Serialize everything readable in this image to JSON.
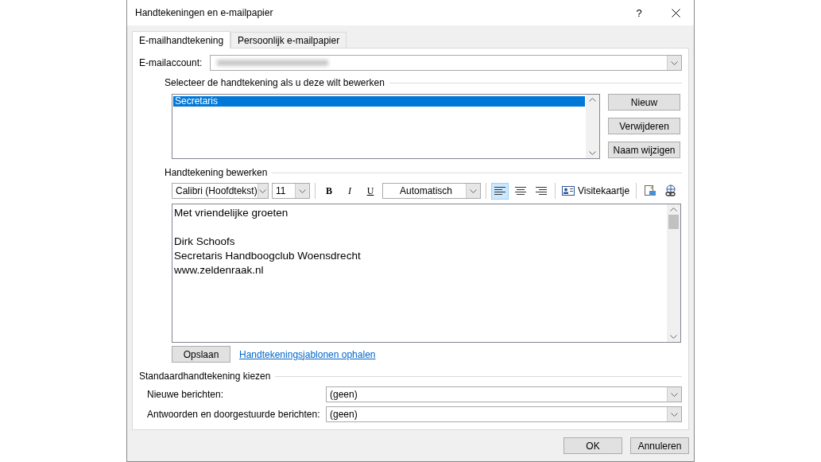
{
  "window": {
    "title": "Handtekeningen en e-mailpapier",
    "help": "?"
  },
  "tabs": [
    {
      "label": "E-mailhandtekening",
      "selected": true
    },
    {
      "label": "Persoonlijk e-mailpapier",
      "selected": false
    }
  ],
  "account": {
    "label": "E-mailaccount:"
  },
  "signatures": {
    "heading": "Selecteer de handtekening als u deze wilt bewerken",
    "items": [
      {
        "label": "Secretaris",
        "selected": true
      }
    ],
    "buttons": [
      "Nieuw",
      "Verwijderen",
      "Naam wijzigen"
    ]
  },
  "editor": {
    "heading": "Handtekening bewerken",
    "font": "Calibri (Hoofdtekst)",
    "size": "11",
    "text_color_choice": "Automatisch",
    "format": [
      {
        "label": "B",
        "kind": "bold"
      },
      {
        "label": "I",
        "kind": "italic"
      },
      {
        "label": "U",
        "kind": "underline"
      }
    ],
    "align": [
      {
        "kind": "left",
        "selected": true
      },
      {
        "kind": "center",
        "selected": false
      },
      {
        "kind": "right",
        "selected": false
      }
    ],
    "business_card": "Visitekaartje",
    "paragraphs": [
      [
        "Met vriendelijke groeten"
      ],
      [
        "Dirk Schoofs",
        "Secretaris Handboogclub Woensdrecht",
        "www.zeldenraak.nl"
      ]
    ]
  },
  "save": "Opslaan",
  "templates_link": "Handtekeningsjablonen ophalen",
  "defaults": {
    "heading": "Standaardhandtekening kiezen",
    "rows": [
      {
        "label": "Nieuwe berichten:",
        "value": "(geen)"
      },
      {
        "label": "Antwoorden en doorgestuurde berichten:",
        "value": "(geen)"
      }
    ]
  },
  "buttons": [
    "OK",
    "Annuleren"
  ]
}
